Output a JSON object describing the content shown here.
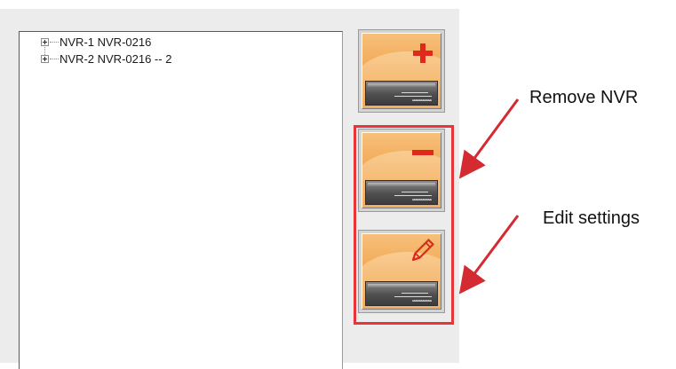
{
  "tree": {
    "items": [
      {
        "label": "NVR-1 NVR-0216"
      },
      {
        "label": "NVR-2 NVR-0216 -- 2"
      }
    ]
  },
  "buttons": [
    {
      "name": "add-nvr",
      "icon": "add-nvr-icon"
    },
    {
      "name": "remove-nvr",
      "icon": "remove-nvr-icon"
    },
    {
      "name": "edit-nvr",
      "icon": "edit-nvr-icon"
    }
  ],
  "callouts": {
    "remove": "Remove NVR",
    "edit": "Edit settings"
  },
  "colors": {
    "highlight": "#e8353a",
    "accent_orange": "#f2a24c",
    "sign_red": "#e0281c",
    "arrow": "#d42a32"
  }
}
